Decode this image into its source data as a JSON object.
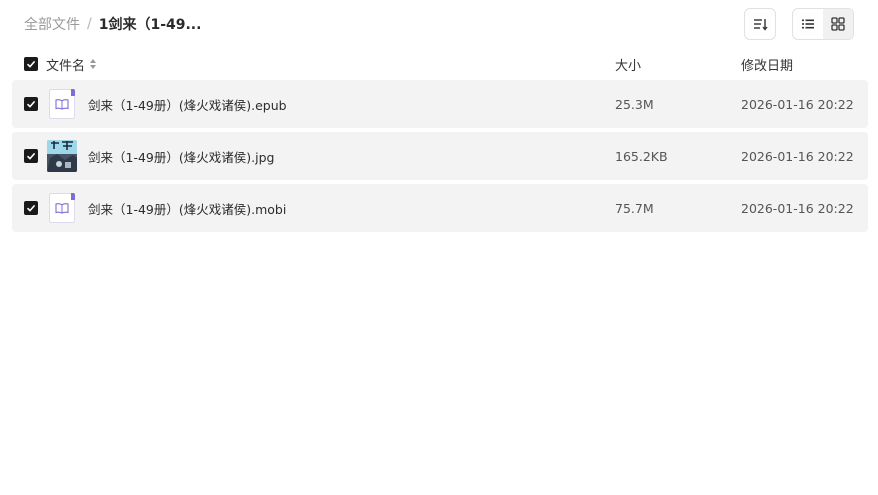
{
  "breadcrumb": {
    "root": "全部文件",
    "separator": "/",
    "current": "1剑来（1-49..."
  },
  "toolbar": {
    "sort_icon": "sort-icon",
    "list_icon": "list-view-icon",
    "grid_icon": "grid-view-icon"
  },
  "table": {
    "headers": {
      "name": "文件名",
      "size": "大小",
      "date": "修改日期"
    },
    "rows": [
      {
        "name": "剑来（1-49册）(烽火戏诸侯).epub",
        "size": "25.3M",
        "date": "2026-01-16 20:22",
        "icon": "ebook-icon",
        "checked": true
      },
      {
        "name": "剑来（1-49册）(烽火戏诸侯).jpg",
        "size": "165.2KB",
        "date": "2026-01-16 20:22",
        "icon": "image-thumbnail",
        "checked": true
      },
      {
        "name": "剑来（1-49册）(烽火戏诸侯).mobi",
        "size": "75.7M",
        "date": "2026-01-16 20:22",
        "icon": "ebook-icon",
        "checked": true
      }
    ]
  },
  "colors": {
    "checkbox": "#1a1a1a",
    "row_bg": "#f3f3f3",
    "ebook_accent": "#7b6fd6"
  }
}
